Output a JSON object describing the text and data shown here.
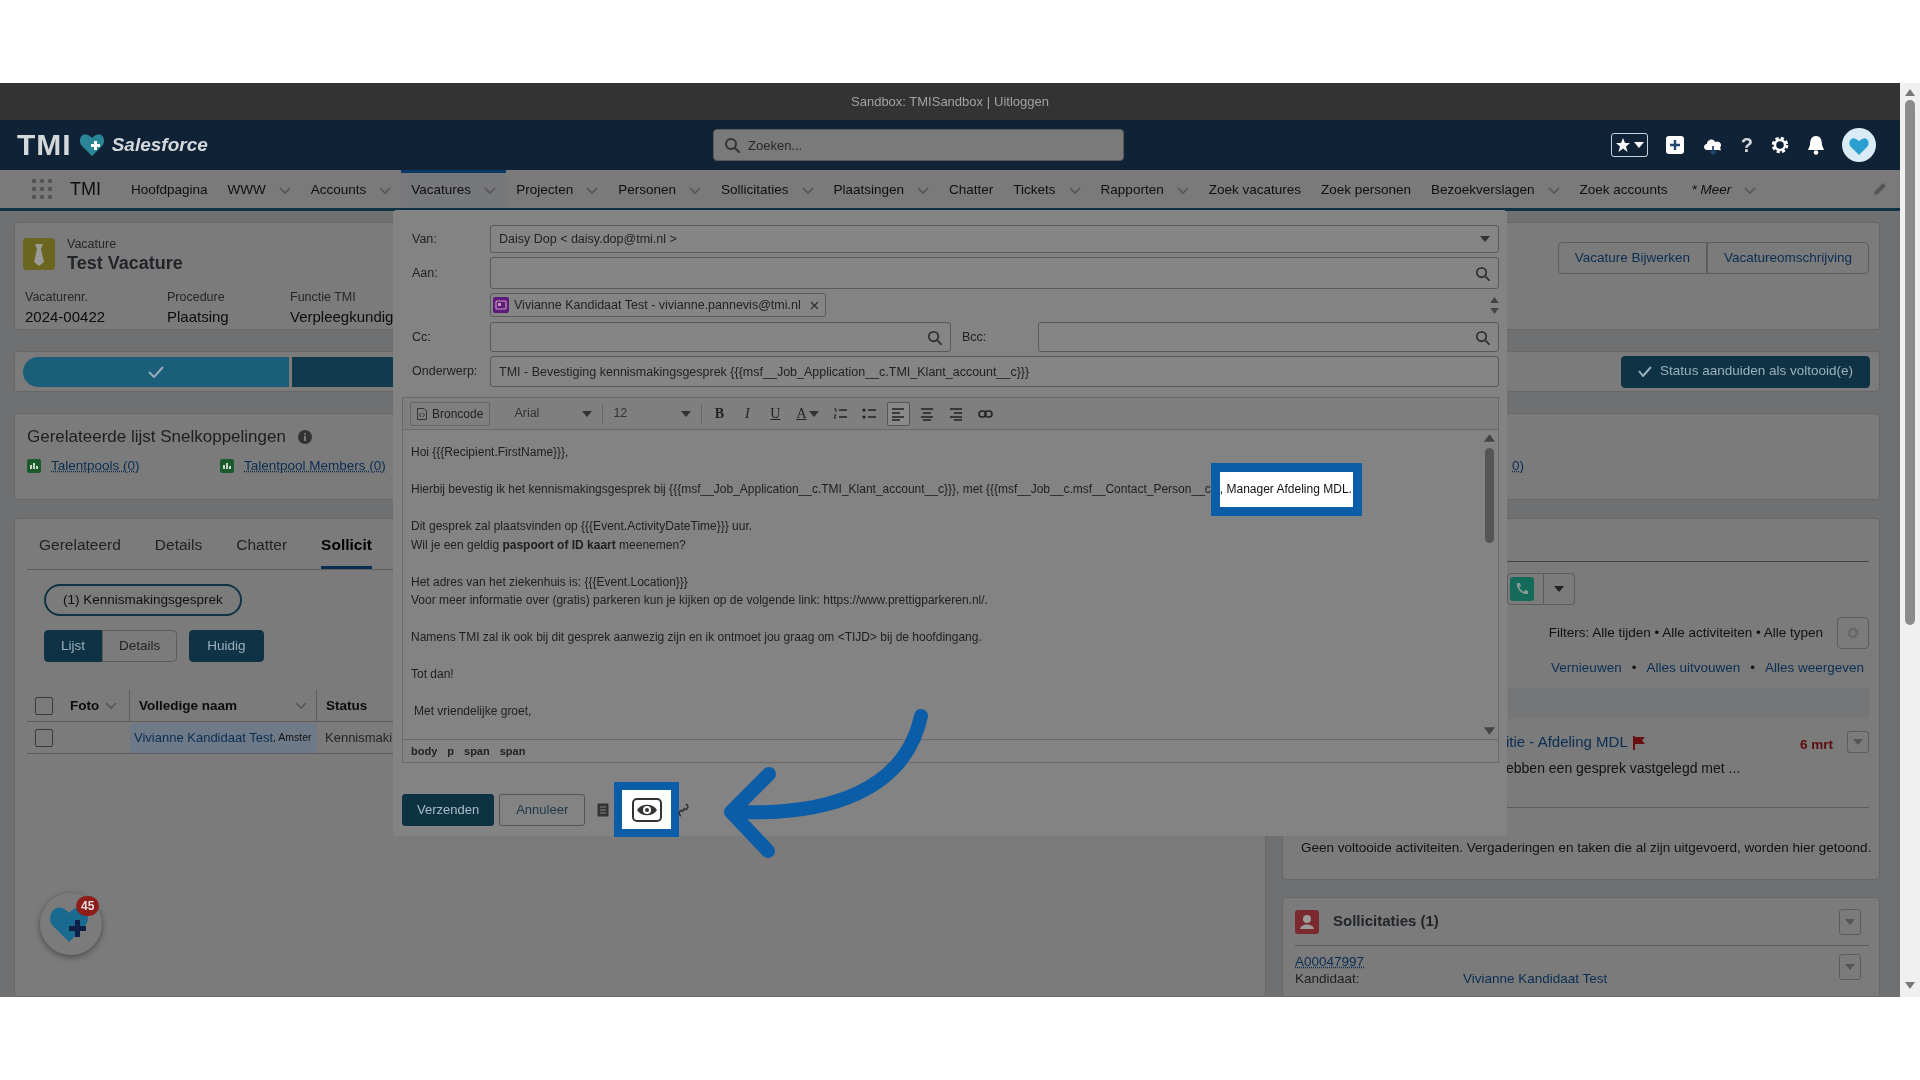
{
  "sandbox_bar": {
    "text": "Sandbox: TMISandbox | ",
    "link": "Uitloggen"
  },
  "header": {
    "logo": "TMI",
    "brand": "Salesforce",
    "search": {
      "placeholder": "Zoeken..."
    },
    "help": "?"
  },
  "nav": {
    "app_name": "TMI",
    "items": [
      {
        "label": "Hoofdpagina",
        "dropdown": false,
        "selected": false
      },
      {
        "label": "WWW",
        "dropdown": true,
        "selected": false
      },
      {
        "label": "Accounts",
        "dropdown": true,
        "selected": false
      },
      {
        "label": "Vacatures",
        "dropdown": true,
        "selected": true
      },
      {
        "label": "Projecten",
        "dropdown": true,
        "selected": false
      },
      {
        "label": "Personen",
        "dropdown": true,
        "selected": false
      },
      {
        "label": "Sollicitaties",
        "dropdown": true,
        "selected": false
      },
      {
        "label": "Plaatsingen",
        "dropdown": true,
        "selected": false
      },
      {
        "label": "Chatter",
        "dropdown": false,
        "selected": false
      },
      {
        "label": "Tickets",
        "dropdown": true,
        "selected": false
      },
      {
        "label": "Rapporten",
        "dropdown": true,
        "selected": false
      },
      {
        "label": "Zoek vacatures",
        "dropdown": false,
        "selected": false
      },
      {
        "label": "Zoek personen",
        "dropdown": false,
        "selected": false
      },
      {
        "label": "Bezoekverslagen",
        "dropdown": true,
        "selected": false
      },
      {
        "label": "Zoek accounts",
        "dropdown": false,
        "selected": false
      },
      {
        "label": "* Meer",
        "dropdown": true,
        "selected": false
      }
    ]
  },
  "record": {
    "object": "Vacature",
    "title": "Test Vacature",
    "fields": [
      {
        "label": "Vacaturenr.",
        "value": "2024-00422"
      },
      {
        "label": "Procedure",
        "value": "Plaatsing"
      },
      {
        "label": "Functie TMI",
        "value": "Verpleegkundig"
      }
    ],
    "actions": [
      "Vacature Bijwerken",
      "Vacatureomschrijving"
    ]
  },
  "path": {
    "stages": [
      {
        "complete": true
      },
      {
        "complete": false
      }
    ],
    "action": "Status aanduiden als voltooid(e)"
  },
  "quick_links": {
    "title": "Gerelateerde lijst Snelkoppelingen",
    "links": [
      "Talentpools (0)",
      "Talentpool Members (0)",
      "0)"
    ]
  },
  "related": {
    "tabs": [
      {
        "label": "Gerelateerd",
        "selected": false
      },
      {
        "label": "Details",
        "selected": false
      },
      {
        "label": "Chatter",
        "selected": false
      },
      {
        "label": "Sollicit",
        "selected": true
      }
    ],
    "filter": "(1) Kennismakingsgesprek",
    "views": [
      {
        "label": "Lijst",
        "selected": true
      },
      {
        "label": "Details",
        "selected": false
      }
    ],
    "current": "Huidig",
    "table": {
      "all_checked": false,
      "columns": [
        {
          "label": "Foto",
          "sortable": true
        },
        {
          "label": "Volledige naam",
          "sortable": true
        },
        {
          "label": "Status",
          "sortable": false
        }
      ],
      "rows": [
        {
          "checked": false,
          "name": "Vivianne Kandidaat Test",
          "location": ", Amster",
          "status": "Kennismaki"
        }
      ]
    }
  },
  "fab": {
    "badge": "45"
  },
  "activity": {
    "filters": "Filters: Alle tijden • Alle activiteiten • Alle typen",
    "separator": "•",
    "links": [
      "Vernieuwen",
      "Alles uitvouwen",
      "Alles weergeven"
    ],
    "items": [
      {
        "title": "itie - Afdeling MDL",
        "flagged": true,
        "date": "6 mrt",
        "summary": "ebben een gesprek vastgelegd met ..."
      }
    ],
    "empty_text": "Geen voltooide activiteiten. Vergaderingen en taken die al zijn uitgevoerd, worden hier getoond."
  },
  "applications": {
    "title": "Sollicitaties (1)",
    "items": [
      {
        "number": "A00047997",
        "label": "Kandidaat:",
        "value": "Vivianne Kandidaat Test"
      }
    ]
  },
  "email": {
    "from_label": "Van:",
    "from": "Daisy Dop < daisy.dop@tmi.nl >",
    "to_label": "Aan:",
    "recipients": [
      "Vivianne Kandidaat Test - vivianne.pannevis@tmi.nl"
    ],
    "cc_label": "Cc:",
    "bcc_label": "Bcc:",
    "subject_label": "Onderwerp:",
    "subject": "TMI - Bevestiging kennismakingsgesprek {{{msf__Job_Application__c.TMI_Klant_account__c}}}",
    "toolbar": {
      "source": "Broncode",
      "font": "Arial",
      "point_select": "12",
      "tools": [
        {
          "kind": "bold",
          "label": "B",
          "selected": false
        },
        {
          "kind": "italic",
          "label": "I",
          "selected": false
        },
        {
          "kind": "underline",
          "label": "U",
          "selected": false
        },
        {
          "kind": "text-color",
          "label": "A",
          "selected": false
        },
        {
          "kind": "numbered-list",
          "selected": false
        },
        {
          "kind": "bullet-list",
          "selected": false
        },
        {
          "kind": "align-left",
          "selected": true
        },
        {
          "kind": "align-center",
          "selected": false
        },
        {
          "kind": "align-right",
          "selected": false
        },
        {
          "kind": "link",
          "selected": false
        }
      ]
    },
    "paragraphs": [
      {
        "lines": [
          "Hoi {{{Recipient.FirstName}}},"
        ]
      },
      {
        "lines": [
          "Hierbij bevestig ik het kennismakingsgesprek bij {{{msf__Job_Application__c.TMI_Klant_account__c}}}, met {{{msf__Job__c.msf__Contact_Person__c"
        ],
        "highlight": ", Manager Afdeling MDL."
      },
      {
        "lines": [
          "Dit gesprek zal plaatsvinden op {{{Event.ActivityDateTime}}} uur.",
          "Wil je een geldig **paspoort of ID kaart** meenemen?"
        ]
      },
      {
        "lines": [
          "Het adres van het ziekenhuis is: {{{Event.Location}}}",
          "Voor meer informatie over (gratis) parkeren kun je kijken op de volgende link: https://www.prettigparkeren.nl/."
        ]
      },
      {
        "lines": [
          "Namens TMI zal ik ook bij dit gesprek aanwezig zijn en ik ontmoet jou graag om <TIJD> bij de hoofdingang."
        ]
      },
      {
        "lines": [
          "Tot dan!"
        ]
      },
      {
        "lines": [
          "Met vriendelijke groet,"
        ],
        "indented": true
      }
    ],
    "element_path": [
      "body",
      "p",
      "span",
      "span"
    ],
    "send": "Verzenden",
    "cancel": "Annuleer",
    "preview_highlighted": true
  }
}
